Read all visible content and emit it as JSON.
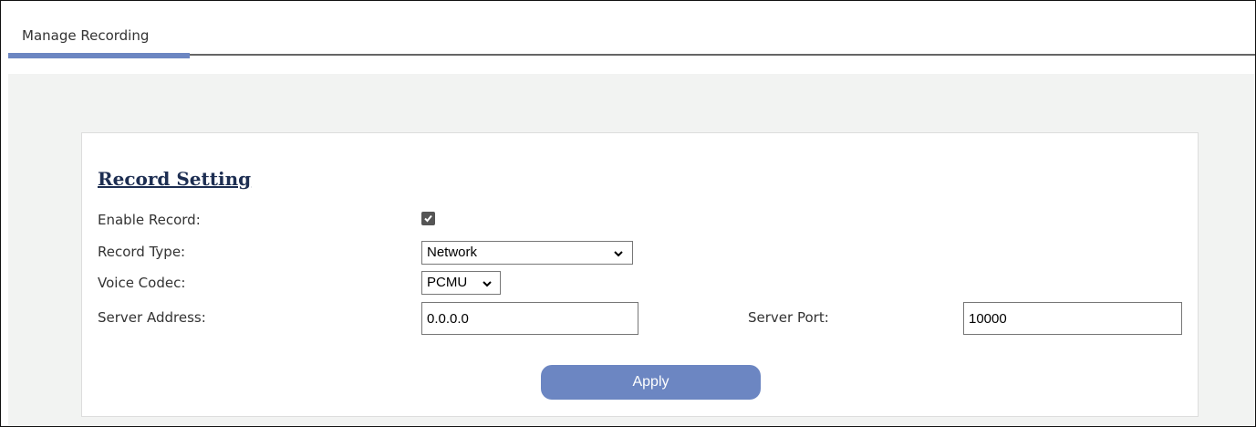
{
  "tabs": [
    {
      "label": "Manage Recording"
    }
  ],
  "section": {
    "title": "Record Setting"
  },
  "fields": {
    "enable_record": {
      "label": "Enable Record:",
      "checked": true
    },
    "record_type": {
      "label": "Record Type:",
      "value": "Network"
    },
    "voice_codec": {
      "label": "Voice Codec:",
      "value": "PCMU"
    },
    "server_address": {
      "label": "Server Address:",
      "value": "0.0.0.0"
    },
    "server_port": {
      "label": "Server Port:",
      "value": "10000"
    }
  },
  "apply_label": "Apply",
  "colors": {
    "accent": "#6c86c2",
    "title": "#1d2e52",
    "background": "#f2f3f2"
  }
}
